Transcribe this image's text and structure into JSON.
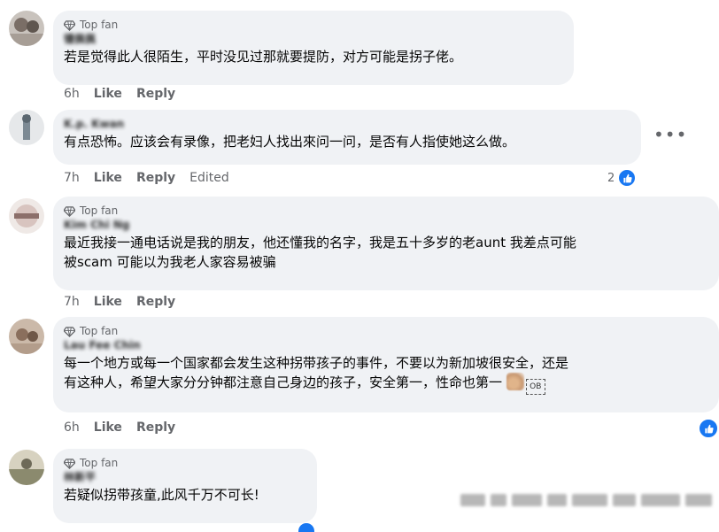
{
  "badge": {
    "label": "Top fan",
    "icon": "diamond-icon"
  },
  "actions": {
    "like": "Like",
    "reply": "Reply",
    "edited": "Edited"
  },
  "colors": {
    "accent": "#1877f2",
    "bubble": "#f0f2f5",
    "meta": "#65676b"
  },
  "comments": [
    {
      "author": "锺佩佩",
      "top_fan": true,
      "text": "若是觉得此人很陌生，平时没见过那就要提防，对方可能是拐子佬。",
      "time": "6h"
    },
    {
      "author": "K.p. Kwan",
      "top_fan": false,
      "text": "有点恐怖。应该会有录像，把老妇人找出來问一问，是否有人指使她这么做。",
      "time": "7h",
      "edited": true,
      "reactions": "2"
    },
    {
      "author": "Kim Chi Ng",
      "top_fan": true,
      "text_line1": "最近我接一通电话说是我的朋友，他还懂我的名字，我是五十多岁的老aunt 我差点可能",
      "text_line2": "被scam 可能以为我老人家容易被骗",
      "time": "7h"
    },
    {
      "author": "Lau Fee Chin",
      "top_fan": true,
      "text_line1": "每一个地方或每一个国家都会发生这种拐带孩子的事件，不要以为新加坡很安全，还是",
      "text_line2": "有这种人，希望大家分分钟都注意自己身边的孩子，安全第一，性命也第一",
      "emoji_text": "OB",
      "time": "6h"
    },
    {
      "author": "林新平",
      "top_fan": true,
      "text": "若疑似拐带孩童,此风千万不可长!"
    }
  ]
}
